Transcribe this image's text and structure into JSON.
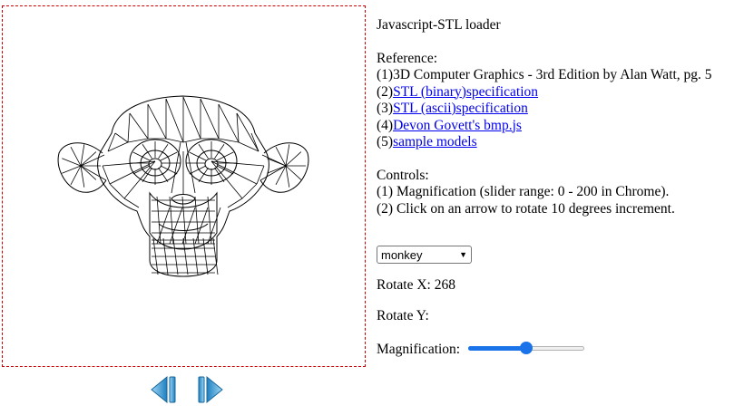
{
  "title": "Javascript-STL loader",
  "reference": {
    "heading": "Reference:",
    "items": [
      {
        "prefix": "(1)",
        "text": "3D Computer Graphics - 3rd Edition by Alan Watt, pg. 5",
        "link": false
      },
      {
        "prefix": "(2)",
        "text": "STL (binary)specification",
        "link": true
      },
      {
        "prefix": "(3)",
        "text": "STL (ascii)specification",
        "link": true
      },
      {
        "prefix": "(4)",
        "text": "Devon Govett's bmp.js",
        "link": true
      },
      {
        "prefix": "(5)",
        "text": "sample models",
        "link": true
      }
    ]
  },
  "controls": {
    "heading": "Controls:",
    "items": [
      "(1) Magnification (slider range: 0 - 200 in Chrome).",
      "(2) Click on an arrow to rotate 10 degrees increment."
    ]
  },
  "model_select": {
    "selected": "monkey"
  },
  "rotate_x": {
    "label": "Rotate X:",
    "value": "268"
  },
  "rotate_y": {
    "label": "Rotate Y:",
    "value": ""
  },
  "magnification": {
    "label": "Magnification:",
    "value": 100,
    "min": 0,
    "max": 200
  },
  "arrows": {
    "left_icon": "arrow-left-icon",
    "right_icon": "arrow-right-icon",
    "color": "#3aa0d8"
  },
  "colors": {
    "canvas_border": "#cc0000",
    "link": "#0000ee",
    "slider_accent": "#1a73e8"
  }
}
